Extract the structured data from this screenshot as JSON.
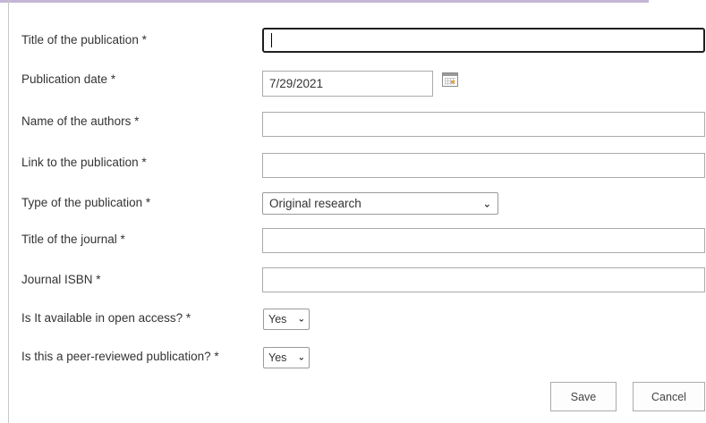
{
  "form": {
    "fields": {
      "title_publication": {
        "label": "Title of the publication *",
        "value": ""
      },
      "publication_date": {
        "label": "Publication date *",
        "value": "7/29/2021"
      },
      "authors": {
        "label": "Name of the authors *",
        "value": ""
      },
      "link": {
        "label": "Link to the publication *",
        "value": ""
      },
      "type": {
        "label": "Type of the publication *",
        "selected": "Original research"
      },
      "journal_title": {
        "label": "Title of the journal *",
        "value": ""
      },
      "journal_isbn": {
        "label": "Journal ISBN *",
        "value": ""
      },
      "open_access": {
        "label": "Is It available in open access? *",
        "selected": "Yes"
      },
      "peer_reviewed": {
        "label": "Is this a peer-reviewed publication? *",
        "selected": "Yes"
      }
    },
    "actions": {
      "save_label": "Save",
      "cancel_label": "Cancel"
    },
    "icons": {
      "date_picker": "calendar-icon",
      "dropdown": "chevron-down-icon"
    },
    "colors": {
      "top_accent": "#c3b6d6",
      "focus_border": "#1f1f1f"
    }
  }
}
